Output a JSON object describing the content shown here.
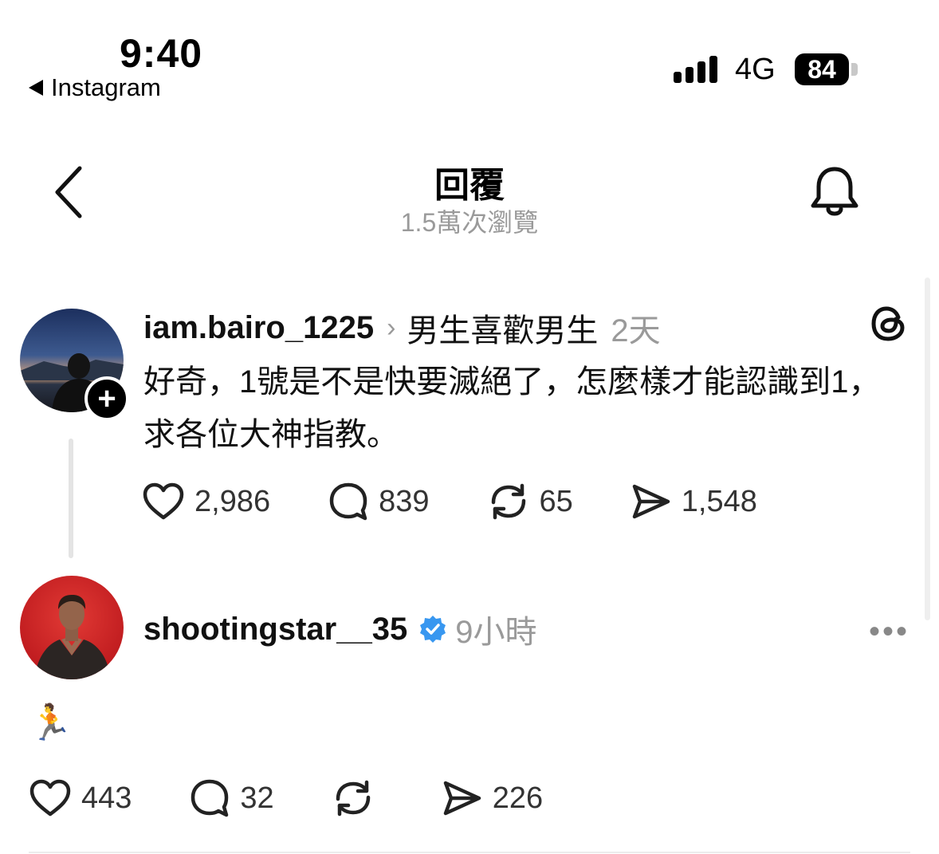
{
  "status_bar": {
    "time": "9:40",
    "back_app": "Instagram",
    "network": "4G",
    "battery": "84"
  },
  "header": {
    "title": "回覆",
    "subtitle": "1.5萬次瀏覽"
  },
  "post": {
    "username": "iam.bairo_1225",
    "topic": "男生喜歡男生",
    "time": "2天",
    "text": "好奇，1號是不是快要滅絕了，怎麼樣才能認識到1，求各位大神指教。",
    "likes": "2,986",
    "comments": "839",
    "reposts": "65",
    "shares": "1,548"
  },
  "reply": {
    "username": "shootingstar__35",
    "time": "9小時",
    "more": "•••",
    "text": "🏃",
    "likes": "443",
    "comments": "32",
    "reposts": "",
    "shares": "226"
  },
  "colors": {
    "verified": "#3897f0",
    "muted": "#9a9a9a"
  }
}
